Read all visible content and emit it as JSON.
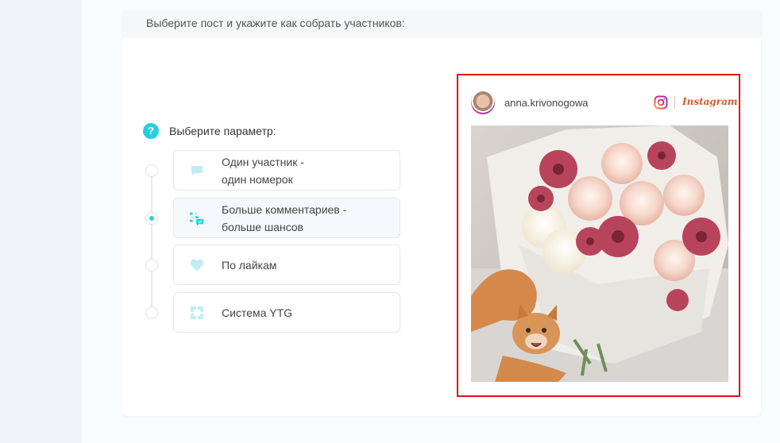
{
  "header": {
    "title": "Выберите пост и укажите как собрать участников:"
  },
  "params": {
    "title": "Выберите параметр:",
    "help_symbol": "?",
    "options": [
      {
        "line1": "Один участник -",
        "line2": "один номерок",
        "icon": "comment-icon",
        "selected": false
      },
      {
        "line1": "Больше комментариев -",
        "line2": "больше шансов",
        "icon": "comments-multiple-icon",
        "selected": true
      },
      {
        "line1": "По лайкам",
        "line2": "",
        "icon": "heart-icon",
        "selected": false
      },
      {
        "line1": "Система YTG",
        "line2": "",
        "icon": "ytg-grid-icon",
        "selected": false
      }
    ]
  },
  "post": {
    "username": "anna.krivonogowa",
    "network": "Instagram"
  },
  "colors": {
    "accent": "#27cfdc",
    "highlight_border": "#e0101a",
    "instagram": "#d9582b"
  }
}
